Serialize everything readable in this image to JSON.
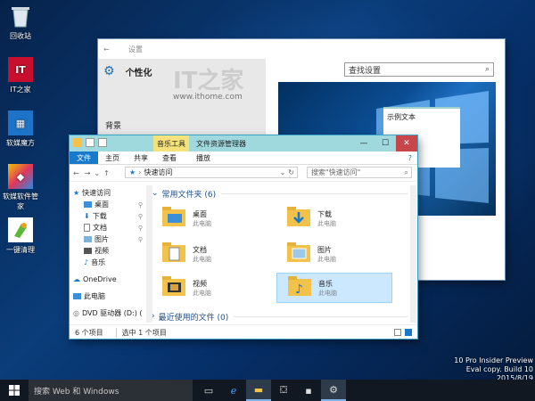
{
  "desktop": {
    "icons": [
      {
        "label": "回收站",
        "icon": "recycle-bin-icon"
      },
      {
        "label": "IT之家",
        "icon": "ithome-app-icon"
      },
      {
        "label": "软媒魔方",
        "icon": "ruanmei-cube-icon"
      },
      {
        "label": "软媒软件管家",
        "icon": "software-manager-icon"
      },
      {
        "label": "一键清理",
        "icon": "cleanup-icon"
      }
    ]
  },
  "settings": {
    "window_title": "设置",
    "page_title": "个性化",
    "search_placeholder": "查找设置",
    "watermark_logo": "IT之家",
    "watermark_url": "www.ithome.com",
    "menu_items": [
      "背景",
      "颜色"
    ],
    "preview_text": "示例文本"
  },
  "explorer": {
    "context_tab": "音乐工具",
    "title": "文件资源管理器",
    "ribbon_tabs": [
      "文件",
      "主页",
      "共享",
      "查看",
      "播放"
    ],
    "address": "快速访问",
    "search_placeholder": "搜索\"快速访问\"",
    "nav": {
      "quick_access": "快速访问",
      "quick_items": [
        "桌面",
        "下载",
        "文档",
        "图片",
        "视频",
        "音乐"
      ],
      "onedrive": "OneDrive",
      "this_pc": "此电脑",
      "dvd": "DVD 驱动器 (D:) ("
    },
    "frequent_group": "常用文件夹 (6)",
    "recent_group": "最近使用的文件 (0)",
    "folders": [
      {
        "name": "桌面",
        "location": "此电脑"
      },
      {
        "name": "下载",
        "location": "此电脑"
      },
      {
        "name": "文档",
        "location": "此电脑"
      },
      {
        "name": "图片",
        "location": "此电脑"
      },
      {
        "name": "视频",
        "location": "此电脑"
      },
      {
        "name": "音乐",
        "location": "此电脑"
      }
    ],
    "status_count": "6 个项目",
    "status_selected": "选中 1 个项目"
  },
  "taskbar": {
    "search_placeholder": "搜索 Web 和 Windows"
  },
  "watermark": {
    "edition": "10 Pro Insider Preview",
    "build": "Eval copy. Build 10",
    "date": "2015/8/19"
  },
  "colors": {
    "accent": "#9fcfcf",
    "explorer_title": "#9fd8dd",
    "file_tab": "#1979ca",
    "selection": "#cce8ff"
  }
}
